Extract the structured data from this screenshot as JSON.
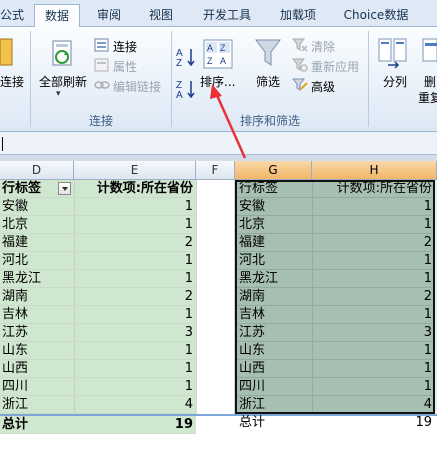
{
  "ribbon": {
    "tabs": [
      {
        "label": "公式"
      },
      {
        "label": "数据"
      },
      {
        "label": "审阅"
      },
      {
        "label": "视图"
      },
      {
        "label": "开发工具"
      },
      {
        "label": "加载项"
      },
      {
        "label": "Choice数据"
      }
    ],
    "active_tab": "数据",
    "connections_group": {
      "partial_left_label": "连接",
      "refresh_all": "全部刷新",
      "connections": "连接",
      "properties": "属性",
      "edit_links": "编辑链接",
      "title": "连接"
    },
    "sort_filter_group": {
      "sort": "排序...",
      "filter": "筛选",
      "clear": "清除",
      "reapply": "重新应用",
      "advanced": "高级",
      "title": "排序和筛选"
    },
    "data_tools_group": {
      "text_to_columns": "分列",
      "partial_delete": "删",
      "partial_duplicate": "重复"
    }
  },
  "formula_bar": {
    "text": ""
  },
  "columns": [
    "D",
    "E",
    "F",
    "G",
    "H"
  ],
  "pivot_left": {
    "header_label": "行标签",
    "header_value": "计数项:所在省份",
    "rows": [
      {
        "label": "安徽",
        "value": "1"
      },
      {
        "label": "北京",
        "value": "1"
      },
      {
        "label": "福建",
        "value": "2"
      },
      {
        "label": "河北",
        "value": "1"
      },
      {
        "label": "黑龙江",
        "value": "1"
      },
      {
        "label": "湖南",
        "value": "2"
      },
      {
        "label": "吉林",
        "value": "1"
      },
      {
        "label": "江苏",
        "value": "3"
      },
      {
        "label": "山东",
        "value": "1"
      },
      {
        "label": "山西",
        "value": "1"
      },
      {
        "label": "四川",
        "value": "1"
      },
      {
        "label": "浙江",
        "value": "4"
      }
    ],
    "total_label": "总计",
    "total_value": "19"
  },
  "pivot_right": {
    "header_label": "行标签",
    "header_value": "计数项:所在省份",
    "rows": [
      {
        "label": "安徽",
        "value": "1"
      },
      {
        "label": "北京",
        "value": "1"
      },
      {
        "label": "福建",
        "value": "2"
      },
      {
        "label": "河北",
        "value": "1"
      },
      {
        "label": "黑龙江",
        "value": "1"
      },
      {
        "label": "湖南",
        "value": "2"
      },
      {
        "label": "吉林",
        "value": "1"
      },
      {
        "label": "江苏",
        "value": "3"
      },
      {
        "label": "山东",
        "value": "1"
      },
      {
        "label": "山西",
        "value": "1"
      },
      {
        "label": "四川",
        "value": "1"
      },
      {
        "label": "浙江",
        "value": "4"
      }
    ],
    "total_label": "总计",
    "total_value": "19"
  },
  "colors": {
    "pivot_fill": "#cfe6cf",
    "selection_fill": "#a6bfb0",
    "arrow": "#e8313a",
    "ribbon_title": "#3f5f86"
  }
}
